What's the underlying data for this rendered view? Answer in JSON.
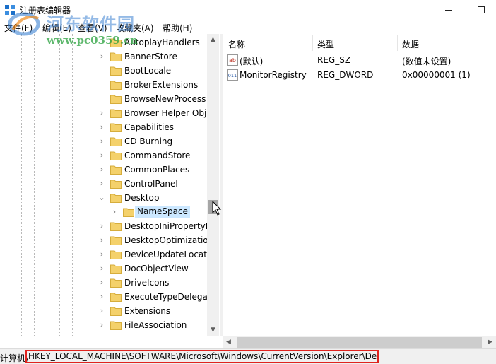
{
  "window": {
    "title": "注册表编辑器",
    "minimize_glyph": "—",
    "maximize_glyph": "☐"
  },
  "watermark": {
    "title": "河东软件园",
    "url": "www.pc0359.cn"
  },
  "menu": {
    "items": [
      {
        "label": "文件(F)"
      },
      {
        "label": "编辑(E)"
      },
      {
        "label": "查看(V)"
      },
      {
        "label": "收藏夹(A)"
      },
      {
        "label": "帮助(H)"
      }
    ]
  },
  "tree": {
    "items": [
      {
        "label": "AutoplayHandlers",
        "expander": "",
        "level": 0
      },
      {
        "label": "BannerStore",
        "expander": "›",
        "level": 0
      },
      {
        "label": "BootLocale",
        "expander": "",
        "level": 0
      },
      {
        "label": "BrokerExtensions",
        "expander": "",
        "level": 0
      },
      {
        "label": "BrowseNewProcess",
        "expander": "",
        "level": 0
      },
      {
        "label": "Browser Helper Obj",
        "expander": "›",
        "level": 0
      },
      {
        "label": "Capabilities",
        "expander": "›",
        "level": 0
      },
      {
        "label": "CD Burning",
        "expander": "›",
        "level": 0
      },
      {
        "label": "CommandStore",
        "expander": "›",
        "level": 0
      },
      {
        "label": "CommonPlaces",
        "expander": "›",
        "level": 0
      },
      {
        "label": "ControlPanel",
        "expander": "›",
        "level": 0
      },
      {
        "label": "Desktop",
        "expander": "⌄",
        "level": 0
      },
      {
        "label": "NameSpace",
        "expander": "›",
        "level": 1,
        "selected": true
      },
      {
        "label": "DesktopIniPropertyI",
        "expander": "›",
        "level": 0
      },
      {
        "label": "DesktopOptimizatio",
        "expander": "›",
        "level": 0
      },
      {
        "label": "DeviceUpdateLocati",
        "expander": "›",
        "level": 0
      },
      {
        "label": "DocObjectView",
        "expander": "›",
        "level": 0
      },
      {
        "label": "DriveIcons",
        "expander": "›",
        "level": 0
      },
      {
        "label": "ExecuteTypeDelegat",
        "expander": "›",
        "level": 0
      },
      {
        "label": "Extensions",
        "expander": "›",
        "level": 0
      },
      {
        "label": "FileAssociation",
        "expander": "›",
        "level": 0
      }
    ]
  },
  "list": {
    "columns": [
      "名称",
      "类型",
      "数据"
    ],
    "rows": [
      {
        "icon": "string-value-icon",
        "icon_text": "ab",
        "name": "(默认)",
        "type": "REG_SZ",
        "data": "(数值未设置)"
      },
      {
        "icon": "dword-value-icon",
        "icon_text": "011",
        "name": "MonitorRegistry",
        "type": "REG_DWORD",
        "data": "0x00000001 (1)"
      }
    ]
  },
  "status": {
    "prefix": "计算机\\",
    "path": "HKEY_LOCAL_MACHINE\\SOFTWARE\\Microsoft\\Windows\\CurrentVersion\\Explorer\\De",
    "highlight_color": "#e0231f"
  },
  "colors": {
    "selection": "#cce8ff",
    "folder": "#f4d16b",
    "scroll_thumb": "#a6a6a6"
  }
}
